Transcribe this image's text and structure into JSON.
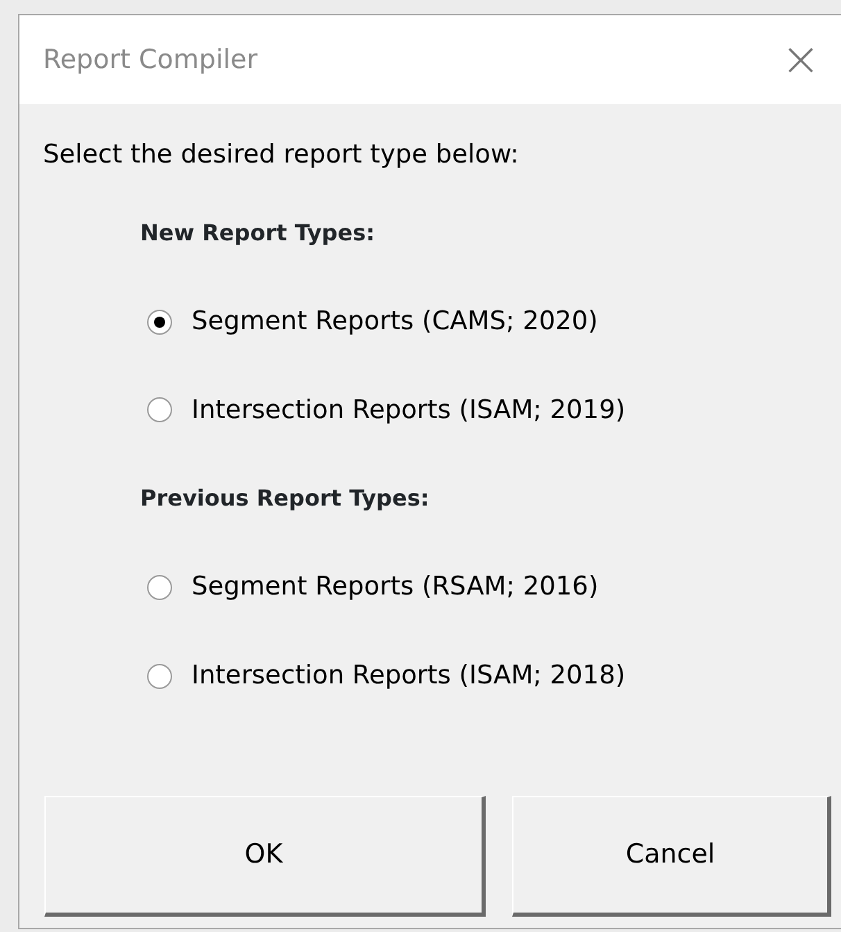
{
  "window": {
    "title": "Report Compiler",
    "close": "×"
  },
  "prompt": "Select the desired report type below:",
  "groups": [
    {
      "heading": "New Report Types:",
      "options": [
        {
          "label": "Segment Reports (CAMS; 2020)",
          "selected": true
        },
        {
          "label": "Intersection Reports (ISAM; 2019)",
          "selected": false
        }
      ]
    },
    {
      "heading": "Previous Report Types:",
      "options": [
        {
          "label": "Segment Reports (RSAM; 2016)",
          "selected": false
        },
        {
          "label": "Intersection Reports (ISAM; 2018)",
          "selected": false
        }
      ]
    }
  ],
  "buttons": [
    "OK",
    "Cancel"
  ]
}
